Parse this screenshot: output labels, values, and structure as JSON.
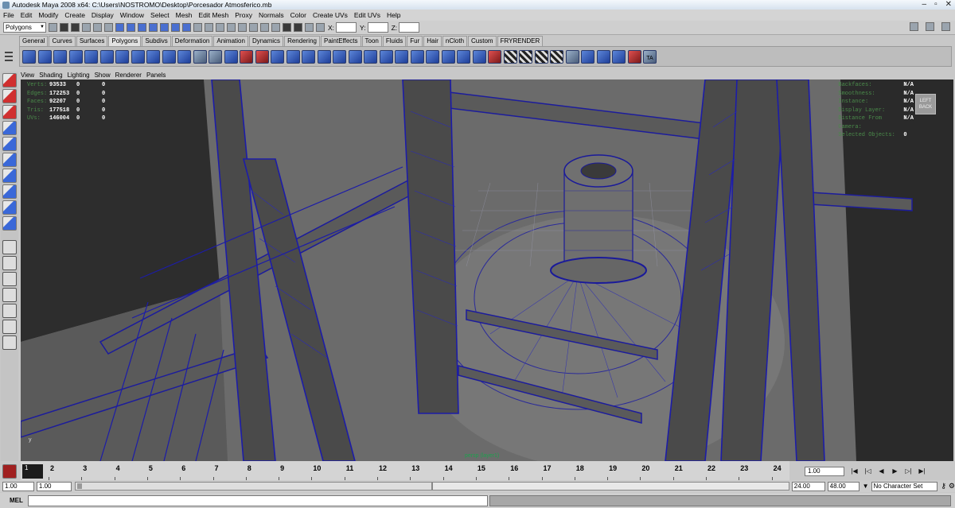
{
  "window": {
    "title": "Autodesk Maya 2008 x64: C:\\Users\\NOSTROMO\\Desktop\\Porcesador Atmosferico.mb"
  },
  "menu": [
    "File",
    "Edit",
    "Modify",
    "Create",
    "Display",
    "Window",
    "Select",
    "Mesh",
    "Edit Mesh",
    "Proxy",
    "Normals",
    "Color",
    "Create UVs",
    "Edit UVs",
    "Help"
  ],
  "status": {
    "mode": "Polygons",
    "x_label": "X:",
    "y_label": "Y:",
    "z_label": "Z:"
  },
  "shelf_tabs": [
    "General",
    "Curves",
    "Surfaces",
    "Polygons",
    "Subdivs",
    "Deformation",
    "Animation",
    "Dynamics",
    "Rendering",
    "PaintEffects",
    "Toon",
    "Fluids",
    "Fur",
    "Hair",
    "nCloth",
    "Custom",
    "FRYRENDER"
  ],
  "shelf_active": "Polygons",
  "shelf_last_label": "TA",
  "panel_menu": [
    "View",
    "Shading",
    "Lighting",
    "Show",
    "Renderer",
    "Panels"
  ],
  "hud": {
    "rows": [
      {
        "label": "Verts:",
        "a": "93533",
        "b": "0",
        "c": "0"
      },
      {
        "label": "Edges:",
        "a": "172253",
        "b": "0",
        "c": "0"
      },
      {
        "label": "Faces:",
        "a": "92207",
        "b": "0",
        "c": "0"
      },
      {
        "label": "Tris:",
        "a": "177518",
        "b": "0",
        "c": "0"
      },
      {
        "label": "UVs:",
        "a": "146004",
        "b": "0",
        "c": "0"
      }
    ],
    "right_rows": [
      {
        "label": "Backfaces:",
        "value": "N/A"
      },
      {
        "label": "Smoothness:",
        "value": "N/A"
      },
      {
        "label": "Instance:",
        "value": "N/A"
      },
      {
        "label": "Display Layer:",
        "value": "N/A"
      },
      {
        "label": "Distance From Camera:",
        "value": "N/A"
      },
      {
        "label": "Selected Objects:",
        "value": "0"
      }
    ],
    "viewcube_top": "LEFT",
    "viewcube_bottom": "BACK",
    "camera_label": "persp (layer1)",
    "axis_label": "y"
  },
  "timeslider": {
    "current_frame": "1",
    "ticks": [
      "2",
      "3",
      "4",
      "5",
      "6",
      "7",
      "8",
      "9",
      "10",
      "11",
      "12",
      "13",
      "14",
      "15",
      "16",
      "17",
      "18",
      "19",
      "20",
      "21",
      "22",
      "23",
      "24"
    ],
    "current_time": "1.00"
  },
  "range": {
    "start_time": "1.00",
    "playback_start": "1.00",
    "playback_end": "24.00",
    "end_time": "48.00",
    "character_set": "No Character Set"
  },
  "mel": {
    "label": "MEL"
  }
}
